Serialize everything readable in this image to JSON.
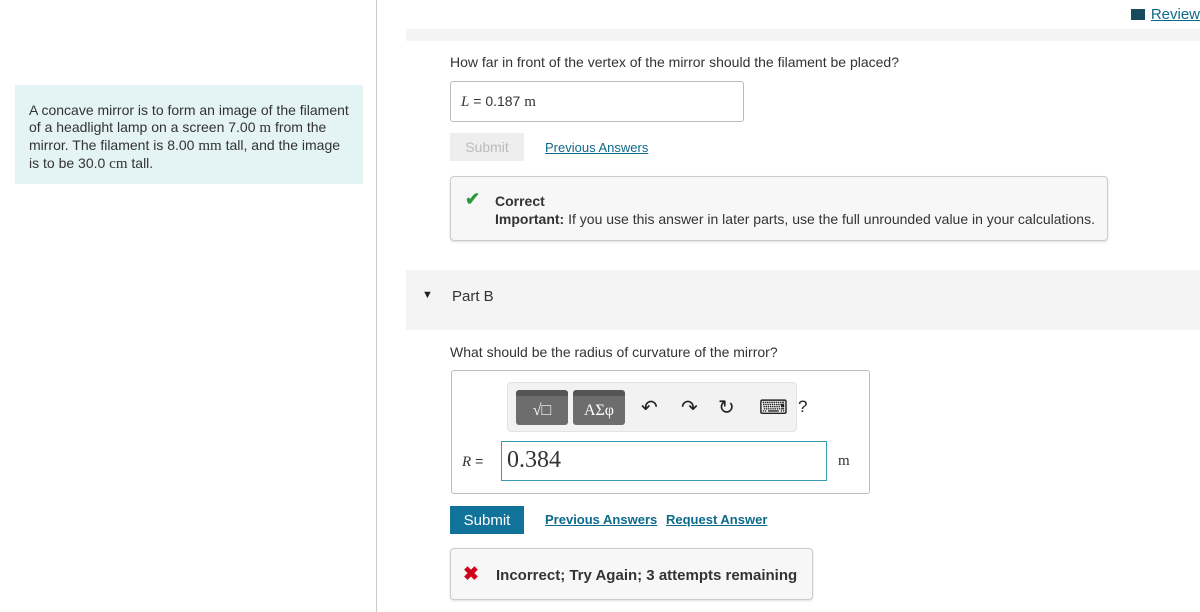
{
  "review": {
    "label": "Review"
  },
  "problem": {
    "text_parts": [
      "A concave mirror is to form an image of the filament of a headlight lamp on a screen 7.00 ",
      "m",
      " from the mirror. The filament is 8.00 ",
      "mm",
      " tall, and the image is to be 30.0 ",
      "cm",
      " tall."
    ]
  },
  "partA": {
    "question": "How far in front of the vertex of the mirror should the filament be placed?",
    "var": "L",
    "eq": "=",
    "value": "0.187",
    "unit": "m",
    "submit": "Submit",
    "previous": "Previous Answers",
    "feedback": {
      "status": "Correct",
      "important_label": "Important:",
      "important_text": " If you use this answer in later parts, use the full unrounded value in your calculations."
    }
  },
  "partB": {
    "title": "Part B",
    "question": "What should be the radius of curvature of the mirror?",
    "toolbar": {
      "templates": "√□",
      "greek": "ΑΣφ",
      "undo": "↶",
      "redo": "↷",
      "reset": "↻",
      "keyboard": "⌨",
      "help": "?"
    },
    "var": "R",
    "eq": "=",
    "value": "0.384",
    "unit": "m",
    "submit": "Submit",
    "previous": "Previous Answers",
    "request": "Request Answer",
    "feedback": "Incorrect; Try Again; 3 attempts remaining"
  },
  "colors": {
    "accent": "#117399",
    "correct": "#2a9a3a",
    "incorrect": "#d0021b"
  }
}
